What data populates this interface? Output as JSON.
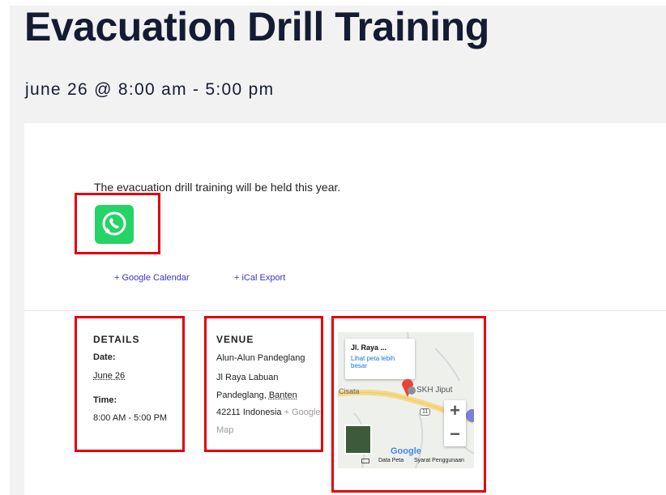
{
  "event": {
    "title": "Evacuation Drill Training",
    "date_range": "june 26 @ 8:00 am - 5:00 pm",
    "description": "The evacuation drill training will be held this year."
  },
  "links": {
    "google_calendar": "+ Google Calendar",
    "ical_export": "+ iCal Export"
  },
  "details": {
    "heading": "DETAILS",
    "date_label": "Date:",
    "date_value": "June 26",
    "time_label": "Time:",
    "time_value": "8:00 AM - 5:00 PM"
  },
  "venue": {
    "heading": "VENUE",
    "name": "Alun-Alun Pandeglang",
    "line1": "Jl Raya Labuan",
    "line2a": "Pandeglang,",
    "line2b": "Banten",
    "line3": "42211 Indonesia",
    "map_link_a": "+ Google",
    "map_link_b": "Map"
  },
  "map": {
    "popup_title": "Jl. Raya ...",
    "popup_link": "Lihat peta lebih besar",
    "label_cisata": "Cisata",
    "label_skh": "SKH Jiput",
    "road_number": "11",
    "zoom_in": "+",
    "zoom_out": "−",
    "google": "Google",
    "data_peta": "Data Peta",
    "syarat": "Syarat Penggunaan"
  },
  "colors": {
    "title": "#141b33",
    "highlight_border": "#e3000f",
    "link": "#3b35c9",
    "whatsapp": "#25d366"
  }
}
